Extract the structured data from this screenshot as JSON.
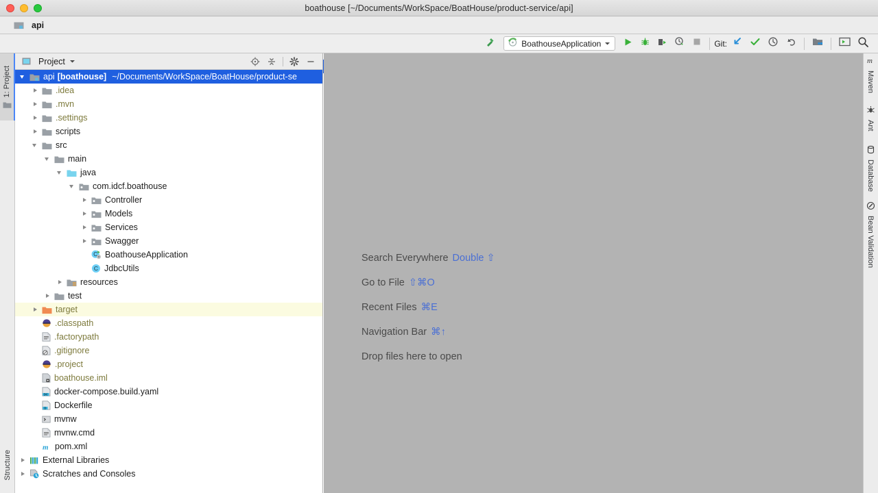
{
  "window": {
    "title": "boathouse [~/Documents/WorkSpace/BoatHouse/product-service/api]",
    "controls": {
      "close": "close-button",
      "minimize": "minimize-button",
      "zoom": "zoom-button"
    }
  },
  "navbar": {
    "label": "api",
    "icon": "module-folder-icon"
  },
  "toolbar": {
    "build_icon": "hammer-icon",
    "run_config": {
      "label": "BoathouseApplication",
      "icon": "spring-boot-icon",
      "chevron": "chevron-down-icon"
    },
    "run_label": "run-icon",
    "debug_label": "debug-icon",
    "run_coverage_label": "run-with-coverage-icon",
    "profile_label": "profiler-icon",
    "stop_label": "stop-icon",
    "git_label": "Git:",
    "git_update": "update-project-icon",
    "git_commit": "commit-icon",
    "git_history": "history-icon",
    "git_revert": "rollback-icon",
    "project_structure": "project-structure-icon",
    "settings_view": "tool-window-icon",
    "search": "search-icon"
  },
  "left_strip": {
    "project": {
      "label": "1: Project",
      "icon": "project-folder-icon"
    },
    "structure": {
      "label": "Structure"
    }
  },
  "right_strip": {
    "items": [
      {
        "label": "Maven",
        "icon": "maven-icon"
      },
      {
        "label": "Ant",
        "icon": "ant-icon"
      },
      {
        "label": "Database",
        "icon": "database-icon"
      },
      {
        "label": "Bean Validation",
        "icon": "bean-validation-icon"
      }
    ]
  },
  "project_panel": {
    "title": "Project",
    "view_icon": "project-view-icon",
    "chevron": "chevron-down-icon",
    "actions": [
      {
        "name": "scroll-from-source-icon"
      },
      {
        "name": "collapse-all-icon"
      },
      {
        "name": "gear-icon"
      },
      {
        "name": "hide-icon"
      }
    ],
    "tree": [
      {
        "indent": 0,
        "arrow": "down",
        "icon": "module-folder-icon",
        "label": "api",
        "module": "[boathouse]",
        "path": "~/Documents/WorkSpace/BoatHouse/product-se",
        "state": "selected"
      },
      {
        "indent": 1,
        "arrow": "right",
        "icon": "folder-icon",
        "label": ".idea",
        "state": "ignored"
      },
      {
        "indent": 1,
        "arrow": "right",
        "icon": "folder-icon",
        "label": ".mvn",
        "state": "ignored"
      },
      {
        "indent": 1,
        "arrow": "right",
        "icon": "folder-icon",
        "label": ".settings",
        "state": "ignored"
      },
      {
        "indent": 1,
        "arrow": "right",
        "icon": "folder-icon",
        "label": "scripts",
        "state": "normal"
      },
      {
        "indent": 1,
        "arrow": "down",
        "icon": "folder-icon",
        "label": "src",
        "state": "normal"
      },
      {
        "indent": 2,
        "arrow": "down",
        "icon": "folder-icon",
        "label": "main",
        "state": "normal"
      },
      {
        "indent": 3,
        "arrow": "down",
        "icon": "source-root-icon",
        "label": "java",
        "state": "normal"
      },
      {
        "indent": 4,
        "arrow": "down",
        "icon": "package-icon",
        "label": "com.idcf.boathouse",
        "state": "normal"
      },
      {
        "indent": 5,
        "arrow": "right",
        "icon": "package-icon",
        "label": "Controller",
        "state": "normal"
      },
      {
        "indent": 5,
        "arrow": "right",
        "icon": "package-icon",
        "label": "Models",
        "state": "normal"
      },
      {
        "indent": 5,
        "arrow": "right",
        "icon": "package-icon",
        "label": "Services",
        "state": "normal"
      },
      {
        "indent": 5,
        "arrow": "right",
        "icon": "package-icon",
        "label": "Swagger",
        "state": "normal"
      },
      {
        "indent": 5,
        "arrow": "none",
        "icon": "java-run-class-icon",
        "label": "BoathouseApplication",
        "state": "normal"
      },
      {
        "indent": 5,
        "arrow": "none",
        "icon": "java-class-icon",
        "label": "JdbcUtils",
        "state": "normal"
      },
      {
        "indent": 3,
        "arrow": "right",
        "icon": "resource-root-icon",
        "label": "resources",
        "state": "normal"
      },
      {
        "indent": 2,
        "arrow": "right",
        "icon": "folder-icon",
        "label": "test",
        "state": "normal"
      },
      {
        "indent": 1,
        "arrow": "right",
        "icon": "excluded-folder-icon",
        "label": "target",
        "state": "highlight"
      },
      {
        "indent": 1,
        "arrow": "none",
        "icon": "eclipse-file-icon",
        "label": ".classpath",
        "state": "ignored"
      },
      {
        "indent": 1,
        "arrow": "none",
        "icon": "text-file-icon",
        "label": ".factorypath",
        "state": "ignored"
      },
      {
        "indent": 1,
        "arrow": "none",
        "icon": "gitignore-file-icon",
        "label": ".gitignore",
        "state": "ignored"
      },
      {
        "indent": 1,
        "arrow": "none",
        "icon": "eclipse-file-icon",
        "label": ".project",
        "state": "ignored"
      },
      {
        "indent": 1,
        "arrow": "none",
        "icon": "iml-file-icon",
        "label": "boathouse.iml",
        "state": "ignored"
      },
      {
        "indent": 1,
        "arrow": "none",
        "icon": "docker-compose-file-icon",
        "label": "docker-compose.build.yaml",
        "state": "normal"
      },
      {
        "indent": 1,
        "arrow": "none",
        "icon": "dockerfile-icon",
        "label": "Dockerfile",
        "state": "normal"
      },
      {
        "indent": 1,
        "arrow": "none",
        "icon": "shell-script-icon",
        "label": "mvnw",
        "state": "normal"
      },
      {
        "indent": 1,
        "arrow": "none",
        "icon": "text-file-icon",
        "label": "mvnw.cmd",
        "state": "normal"
      },
      {
        "indent": 1,
        "arrow": "none",
        "icon": "maven-pom-icon",
        "label": "pom.xml",
        "state": "normal"
      },
      {
        "indent": 0,
        "arrow": "right",
        "icon": "external-libraries-icon",
        "label": "External Libraries",
        "state": "normal"
      },
      {
        "indent": 0,
        "arrow": "right",
        "icon": "scratches-icon",
        "label": "Scratches and Consoles",
        "state": "normal"
      }
    ]
  },
  "editor": {
    "hints": [
      {
        "action": "Search Everywhere",
        "shortcut": "Double ⇧"
      },
      {
        "action": "Go to File",
        "shortcut": "⇧⌘O"
      },
      {
        "action": "Recent Files",
        "shortcut": "⌘E"
      },
      {
        "action": "Navigation Bar",
        "shortcut": "⌘↑"
      },
      {
        "action": "Drop files here to open",
        "shortcut": ""
      }
    ]
  },
  "colors": {
    "accent_blue": "#1f5fe0",
    "shortcut_blue": "#4a6fd4",
    "editor_bg": "#b3b3b3",
    "ignored_olive": "#7d7a3c",
    "highlight_yellow": "#fbfbe0",
    "run_green": "#3ab13a"
  }
}
